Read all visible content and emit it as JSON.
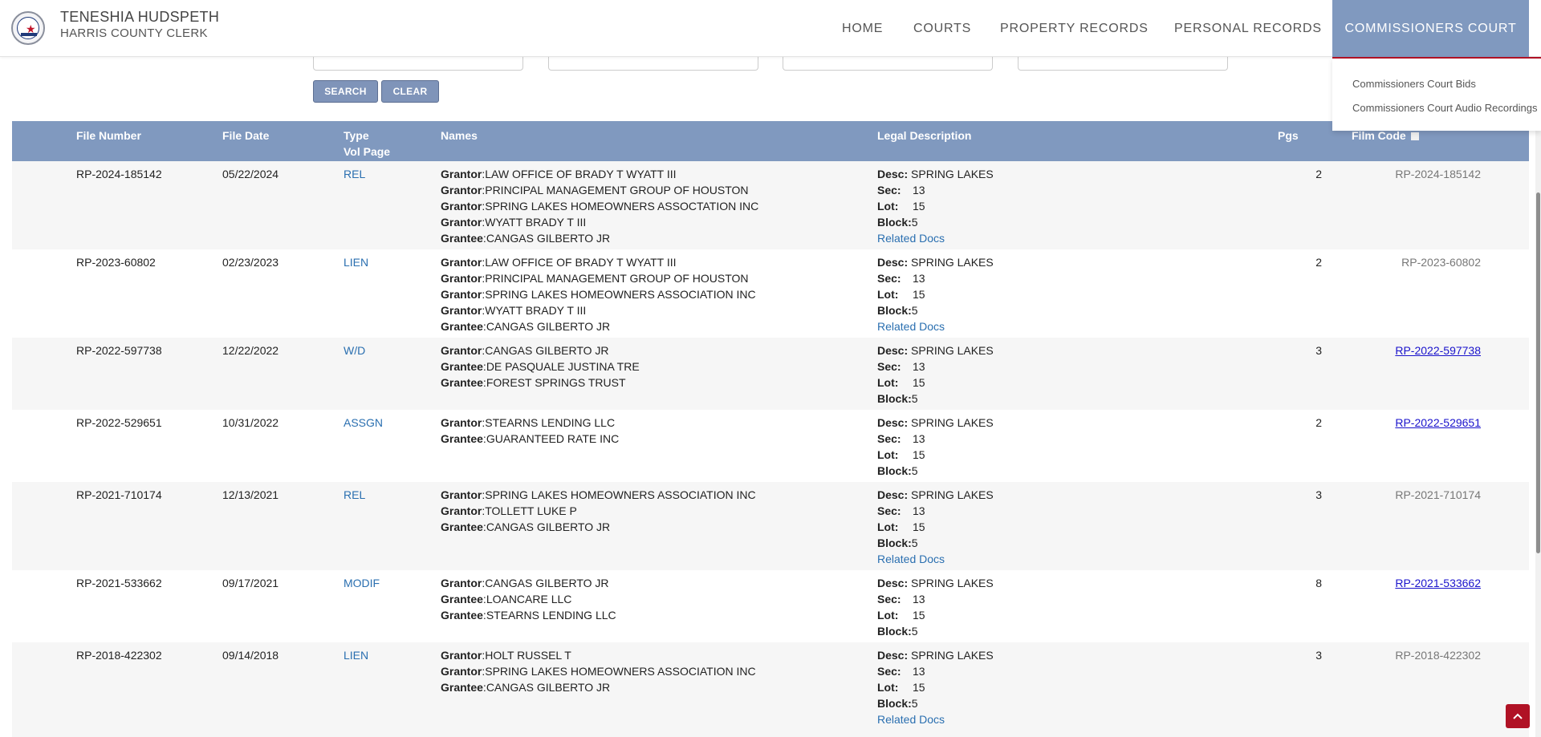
{
  "header": {
    "name": "TENESHIA HUDSPETH",
    "subtitle": "HARRIS COUNTY CLERK"
  },
  "nav": {
    "home": "HOME",
    "courts": "COURTS",
    "property": "PROPERTY RECORDS",
    "personal": "PERSONAL RECORDS",
    "commissioners": "COMMISSIONERS COURT",
    "dropdown": [
      "Commissioners Court Bids",
      "Commissioners Court Audio Recordings"
    ]
  },
  "search": {
    "search_label": "SEARCH",
    "clear_label": "CLEAR"
  },
  "table": {
    "headers": {
      "file_number": "File Number",
      "file_date": "File Date",
      "type": "Type",
      "vol_page": "Vol Page",
      "names": "Names",
      "legal": "Legal Description",
      "pgs": "Pgs",
      "film_code": "Film Code"
    },
    "labels": {
      "desc": "Desc:",
      "sec": "Sec:",
      "lot": "Lot:",
      "block": "Block:",
      "related": "Related Docs"
    },
    "rows": [
      {
        "file_number": "RP-2024-185142",
        "file_date": "05/22/2024",
        "type": "REL",
        "names": [
          {
            "role": "Grantor",
            "name": "LAW OFFICE OF BRADY T WYATT III"
          },
          {
            "role": "Grantor",
            "name": "PRINCIPAL MANAGEMENT GROUP OF HOUSTON"
          },
          {
            "role": "Grantor",
            "name": "SPRING LAKES HOMEOWNERS ASSOCTATION INC"
          },
          {
            "role": "Grantor",
            "name": "WYATT BRADY T III"
          },
          {
            "role": "Grantee",
            "name": "CANGAS GILBERTO JR"
          }
        ],
        "desc": "SPRING LAKES",
        "sec": "13",
        "lot": "15",
        "block": "5",
        "related": true,
        "pgs": "2",
        "film_code": "RP-2024-185142",
        "film_link": false
      },
      {
        "file_number": "RP-2023-60802",
        "file_date": "02/23/2023",
        "type": "LIEN",
        "names": [
          {
            "role": "Grantor",
            "name": "LAW OFFICE OF BRADY T WYATT III"
          },
          {
            "role": "Grantor",
            "name": "PRINCIPAL MANAGEMENT GROUP OF HOUSTON"
          },
          {
            "role": "Grantor",
            "name": "SPRING LAKES HOMEOWNERS ASSOCIATION INC"
          },
          {
            "role": "Grantor",
            "name": "WYATT BRADY T III"
          },
          {
            "role": "Grantee",
            "name": "CANGAS GILBERTO JR"
          }
        ],
        "desc": "SPRING LAKES",
        "sec": "13",
        "lot": "15",
        "block": "5",
        "related": true,
        "pgs": "2",
        "film_code": "RP-2023-60802",
        "film_link": false
      },
      {
        "file_number": "RP-2022-597738",
        "file_date": "12/22/2022",
        "type": "W/D",
        "names": [
          {
            "role": "Grantor",
            "name": "CANGAS GILBERTO JR"
          },
          {
            "role": "Grantee",
            "name": "DE PASQUALE JUSTINA TRE"
          },
          {
            "role": "Grantee",
            "name": "FOREST SPRINGS TRUST"
          }
        ],
        "desc": "SPRING LAKES",
        "sec": "13",
        "lot": "15",
        "block": "5",
        "related": false,
        "pgs": "3",
        "film_code": "RP-2022-597738",
        "film_link": true
      },
      {
        "file_number": "RP-2022-529651",
        "file_date": "10/31/2022",
        "type": "ASSGN",
        "names": [
          {
            "role": "Grantor",
            "name": "STEARNS LENDING LLC"
          },
          {
            "role": "Grantee",
            "name": "GUARANTEED RATE INC"
          }
        ],
        "desc": "SPRING LAKES",
        "sec": "13",
        "lot": "15",
        "block": "5",
        "related": false,
        "pgs": "2",
        "film_code": "RP-2022-529651",
        "film_link": true
      },
      {
        "file_number": "RP-2021-710174",
        "file_date": "12/13/2021",
        "type": "REL",
        "names": [
          {
            "role": "Grantor",
            "name": "SPRING LAKES HOMEOWNERS ASSOCIATION INC"
          },
          {
            "role": "Grantor",
            "name": "TOLLETT LUKE P"
          },
          {
            "role": "Grantee",
            "name": "CANGAS GILBERTO JR"
          }
        ],
        "desc": "SPRING LAKES",
        "sec": "13",
        "lot": "15",
        "block": "5",
        "related": true,
        "pgs": "3",
        "film_code": "RP-2021-710174",
        "film_link": false
      },
      {
        "file_number": "RP-2021-533662",
        "file_date": "09/17/2021",
        "type": "MODIF",
        "names": [
          {
            "role": "Grantor",
            "name": "CANGAS GILBERTO JR"
          },
          {
            "role": "Grantee",
            "name": "LOANCARE LLC"
          },
          {
            "role": "Grantee",
            "name": "STEARNS LENDING LLC"
          }
        ],
        "desc": "SPRING LAKES",
        "sec": "13",
        "lot": "15",
        "block": "5",
        "related": false,
        "pgs": "8",
        "film_code": "RP-2021-533662",
        "film_link": true
      },
      {
        "file_number": "RP-2018-422302",
        "file_date": "09/14/2018",
        "type": "LIEN",
        "names": [
          {
            "role": "Grantor",
            "name": "HOLT RUSSEL T"
          },
          {
            "role": "Grantor",
            "name": "SPRING LAKES HOMEOWNERS ASSOCIATION INC"
          },
          {
            "role": "Grantee",
            "name": "CANGAS GILBERTO JR"
          }
        ],
        "desc": "SPRING LAKES",
        "sec": "13",
        "lot": "15",
        "block": "5",
        "related": true,
        "pgs": "3",
        "film_code": "RP-2018-422302",
        "film_link": false
      }
    ]
  },
  "icons": {
    "logo": "county-seal-icon",
    "back_to_top": "chevron-up-icon"
  }
}
